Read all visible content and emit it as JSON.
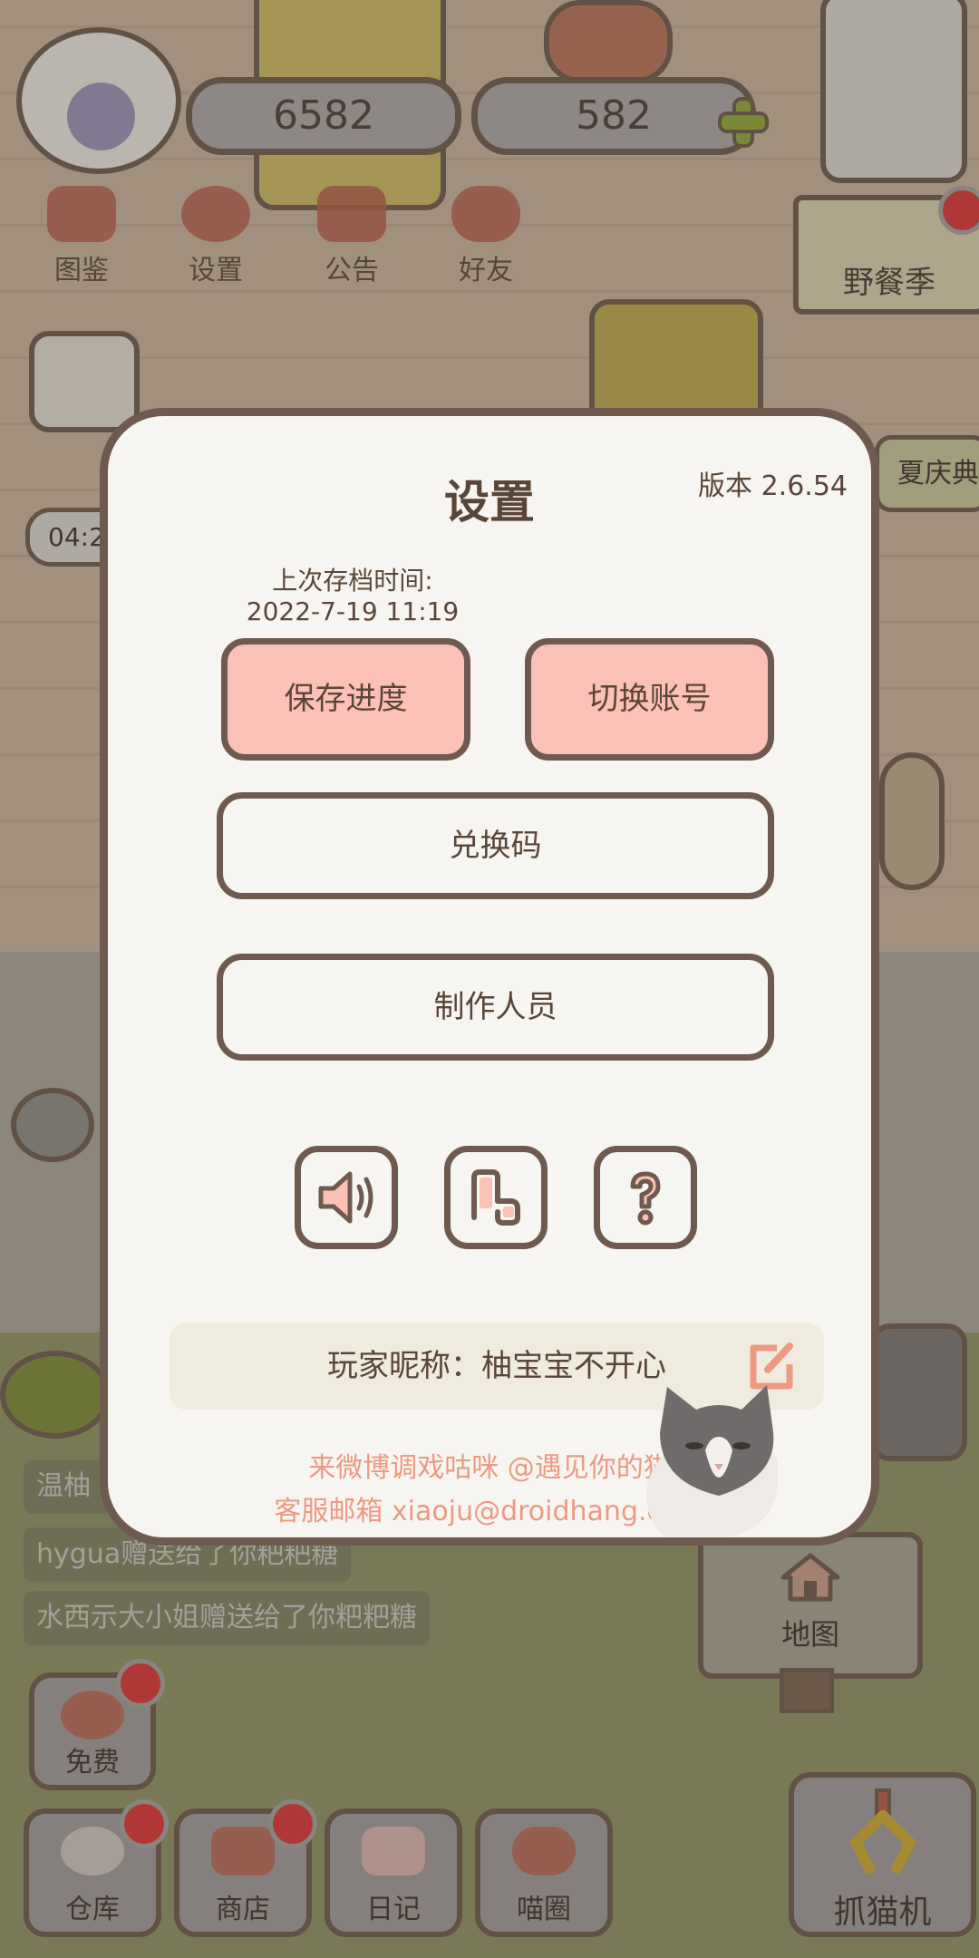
{
  "hud": {
    "coins": "6582",
    "hearts": "582",
    "top_menu": [
      {
        "label": "图鉴",
        "icon": "cat-face-icon"
      },
      {
        "label": "设置",
        "icon": "gear-icon"
      },
      {
        "label": "公告",
        "icon": "gift-icon"
      },
      {
        "label": "好友",
        "icon": "friends-icon"
      }
    ],
    "event_label": "野餐季",
    "side_event_label": "夏庆典",
    "timer_partial": "04:2"
  },
  "chat": {
    "lines": [
      "温柚",
      "hygua赠送给了你粑粑糖",
      "水西示大小姐赠送给了你粑粑糖"
    ]
  },
  "bottom_nav": {
    "free_label": "免费",
    "items": [
      "仓库",
      "商店",
      "日记",
      "喵圈"
    ],
    "map_label": "地图",
    "crane_label": "抓猫机"
  },
  "settings": {
    "title": "设置",
    "version": "版本 2.6.54",
    "last_save_label": "上次存档时间:",
    "last_save_time": "2022-7-19 11:19",
    "save_button": "保存进度",
    "switch_account_button": "切换账号",
    "redeem_code_button": "兑换码",
    "credits_button": "制作人员",
    "icon_buttons": [
      "speaker-icon",
      "music-note-icon",
      "help-icon"
    ],
    "nickname_label": "玩家昵称：柚宝宝不开心",
    "weibo_line": "来微博调戏咕咪 @遇见你的猫",
    "email_line": "客服邮箱 xiaoju@droidhang.com"
  },
  "colors": {
    "modal_bg": "#f7f5f1",
    "outline": "#6e5a4e",
    "pink_button": "#fcc1b6",
    "footer_text": "#ec9a82",
    "badge_red": "#d9363a"
  }
}
